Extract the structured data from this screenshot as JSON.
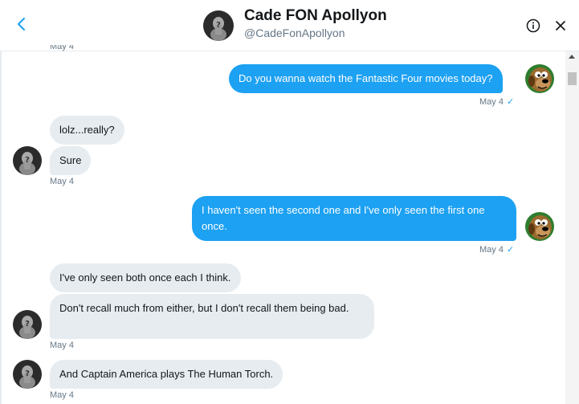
{
  "header": {
    "name": "Cade FON Apollyon",
    "handle": "@CadeFonApollyon"
  },
  "cut_off_date": "May 4",
  "messages": [
    {
      "direction": "outgoing",
      "text": "Do you wanna watch the Fantastic Four movies today?",
      "date": "May 4",
      "read": true
    },
    {
      "direction": "incoming",
      "text": "lolz...really?"
    },
    {
      "direction": "incoming",
      "text": "Sure",
      "date": "May 4"
    },
    {
      "direction": "outgoing",
      "text": "I haven't seen the second one and I've only seen the first one once.",
      "date": "May 4",
      "read": true
    },
    {
      "direction": "incoming",
      "text": "I've only seen both once each I think."
    },
    {
      "direction": "incoming",
      "text": "Don't recall much from either, but I don't recall them being bad.",
      "date": "May 4"
    },
    {
      "direction": "incoming",
      "text": "And Captain America plays The Human Torch.",
      "date": "May 4"
    }
  ],
  "icons": {
    "back": "chevron-left-icon",
    "info": "info-icon",
    "close": "close-icon",
    "read_receipt": "checkmark-icon"
  },
  "colors": {
    "accent": "#1da1f2",
    "incoming_bubble": "#e6ecf0",
    "secondary_text": "#657786"
  }
}
